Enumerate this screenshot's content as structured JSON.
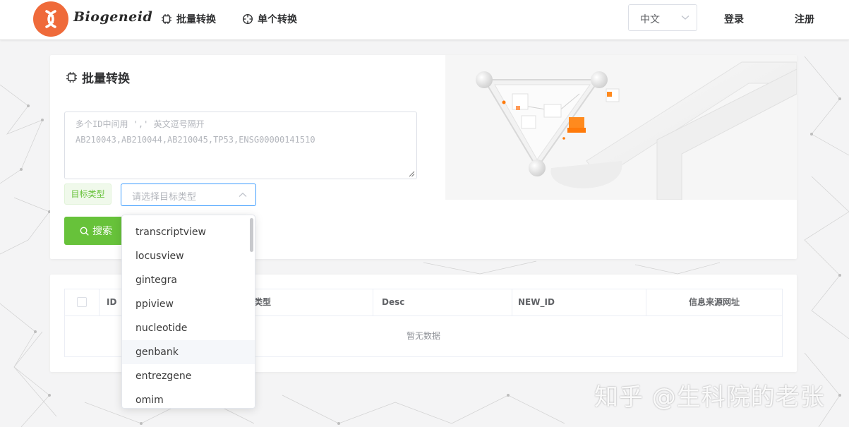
{
  "header": {
    "logo_text": "Biogeneid",
    "nav": [
      {
        "label": "批量转换",
        "icon": "chip-icon"
      },
      {
        "label": "单个转换",
        "icon": "crosshair-icon"
      }
    ],
    "language": {
      "selected": "中文"
    },
    "login_label": "登录",
    "register_label": "注册"
  },
  "batch": {
    "title": "批量转换",
    "textarea": {
      "placeholder_line1": "多个ID中间用 ',' 英文逗号隔开",
      "placeholder_line2": "AB210043,AB210044,AB210045,TP53,ENSG00000141510"
    },
    "target_tag": "目标类型",
    "target_select_placeholder": "请选择目标类型",
    "search_label": "搜索"
  },
  "table": {
    "columns": [
      "ID",
      "类型",
      "Desc",
      "NEW_ID",
      "信息来源网址"
    ],
    "empty_text": "暂无数据"
  },
  "dropdown": {
    "options": [
      "transcriptview",
      "locusview",
      "gintegra",
      "ppiview",
      "nucleotide",
      "genbank",
      "entrezgene",
      "omim"
    ],
    "hovered_index": 5
  },
  "watermark": "知乎 @生科院的老张",
  "colors": {
    "accent_green": "#67c23a",
    "focus_blue": "#409eff",
    "logo_orange": "#ef6a3a"
  }
}
